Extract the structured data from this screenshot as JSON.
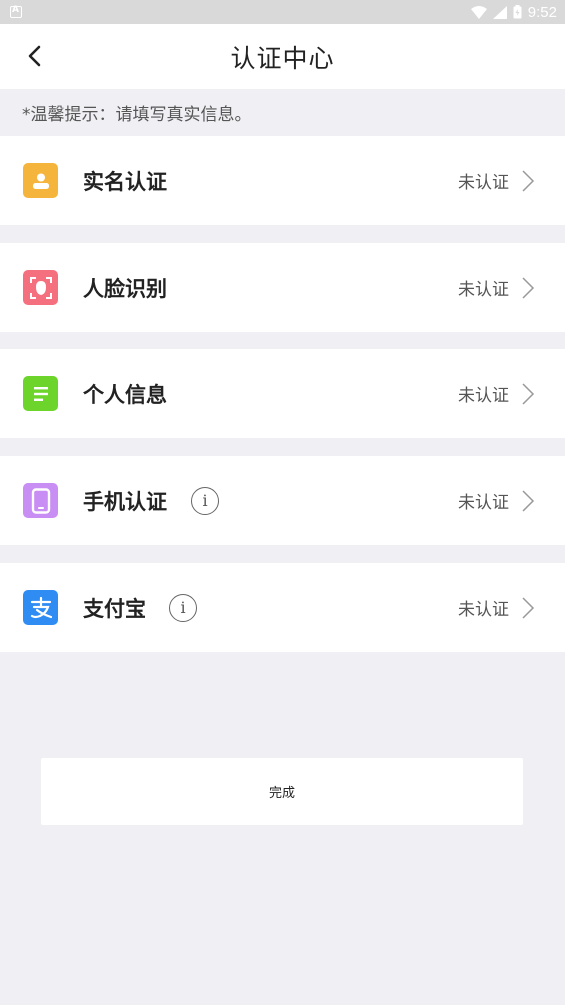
{
  "status_bar": {
    "time": "9:52"
  },
  "header": {
    "title": "认证中心"
  },
  "tip": "*温馨提示：请填写真实信息。",
  "items": [
    {
      "label": "实名认证",
      "status": "未认证",
      "icon": "person-icon",
      "color": "#f5b53d"
    },
    {
      "label": "人脸识别",
      "status": "未认证",
      "icon": "face-scan-icon",
      "color": "#f5707e"
    },
    {
      "label": "个人信息",
      "status": "未认证",
      "icon": "document-icon",
      "color": "#6cd42a"
    },
    {
      "label": "手机认证",
      "status": "未认证",
      "icon": "phone-icon",
      "color": "#c88ef4"
    },
    {
      "label": "支付宝",
      "status": "未认证",
      "icon": "alipay-icon",
      "color": "#2f8cf2"
    }
  ],
  "info_glyph": "i",
  "done_label": "完成"
}
